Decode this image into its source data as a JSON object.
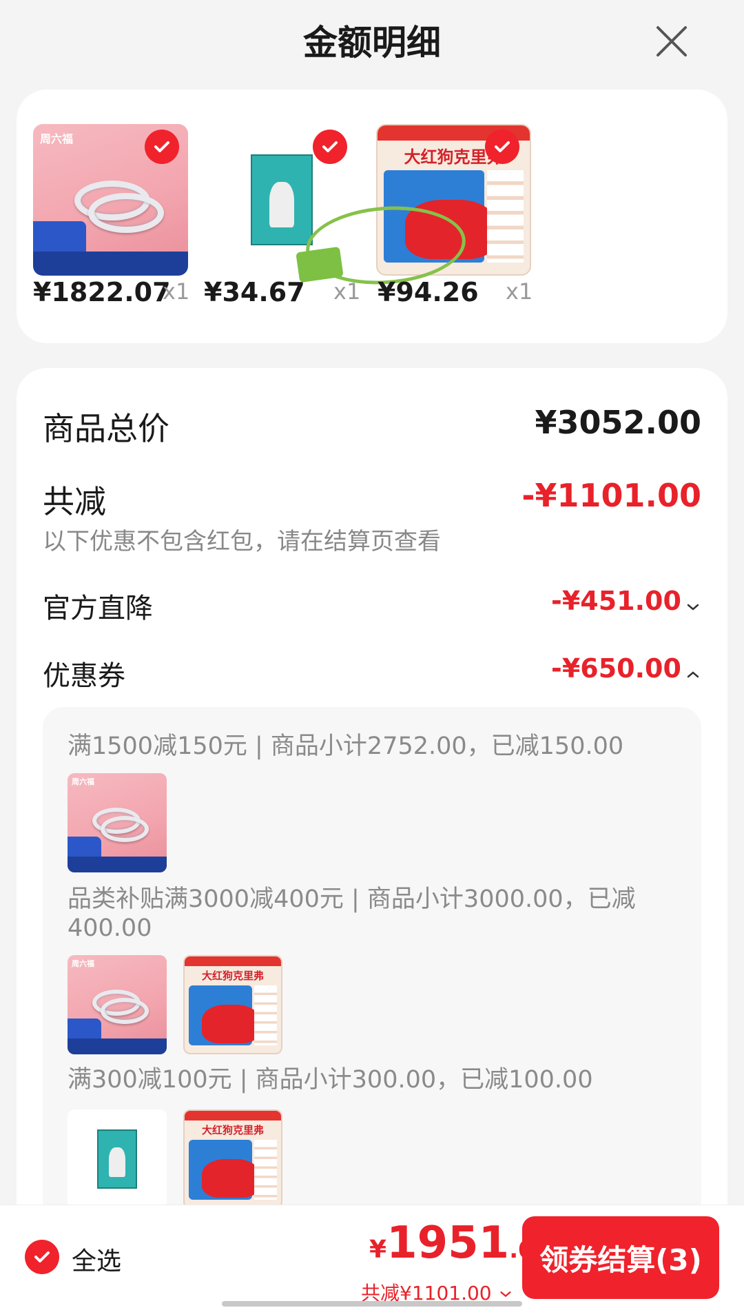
{
  "header": {
    "title": "金额明细"
  },
  "products": [
    {
      "price": "¥1822.07",
      "qty": "x1",
      "image": "silver-rings"
    },
    {
      "price": "¥34.67",
      "qty": "x1",
      "image": "manga-book"
    },
    {
      "price": "¥94.26",
      "qty": "x1",
      "image": "clifford-box",
      "book_title": "大红狗克里弗"
    }
  ],
  "summary": {
    "total_label": "商品总价",
    "total_value": "¥3052.00",
    "discount_label": "共减",
    "discount_value": "-¥1101.00",
    "discount_note": "以下优惠不包含红包，请在结算页查看",
    "official_label": "官方直降",
    "official_value": "-¥451.00",
    "coupon_label": "优惠券",
    "coupon_value": "-¥650.00"
  },
  "coupons": [
    {
      "text": "满1500减150元 | 商品小计2752.00，已减150.00",
      "items": [
        "silver-rings"
      ]
    },
    {
      "text": "品类补贴满3000减400元 | 商品小计3000.00，已减400.00",
      "items": [
        "silver-rings",
        "clifford-box"
      ]
    },
    {
      "text": "满300减100元 | 商品小计300.00，已减100.00",
      "items": [
        "manga-book",
        "clifford-box"
      ]
    }
  ],
  "footer": {
    "select_all": "全选",
    "currency": "¥",
    "total_int": "1951",
    "total_dec": ".00",
    "saved": "共减¥1101.00",
    "pay_button": "领券结算(3)"
  },
  "colors": {
    "accent": "#f0222c",
    "text": "#1a1a1a",
    "muted": "#8a8a8a"
  }
}
